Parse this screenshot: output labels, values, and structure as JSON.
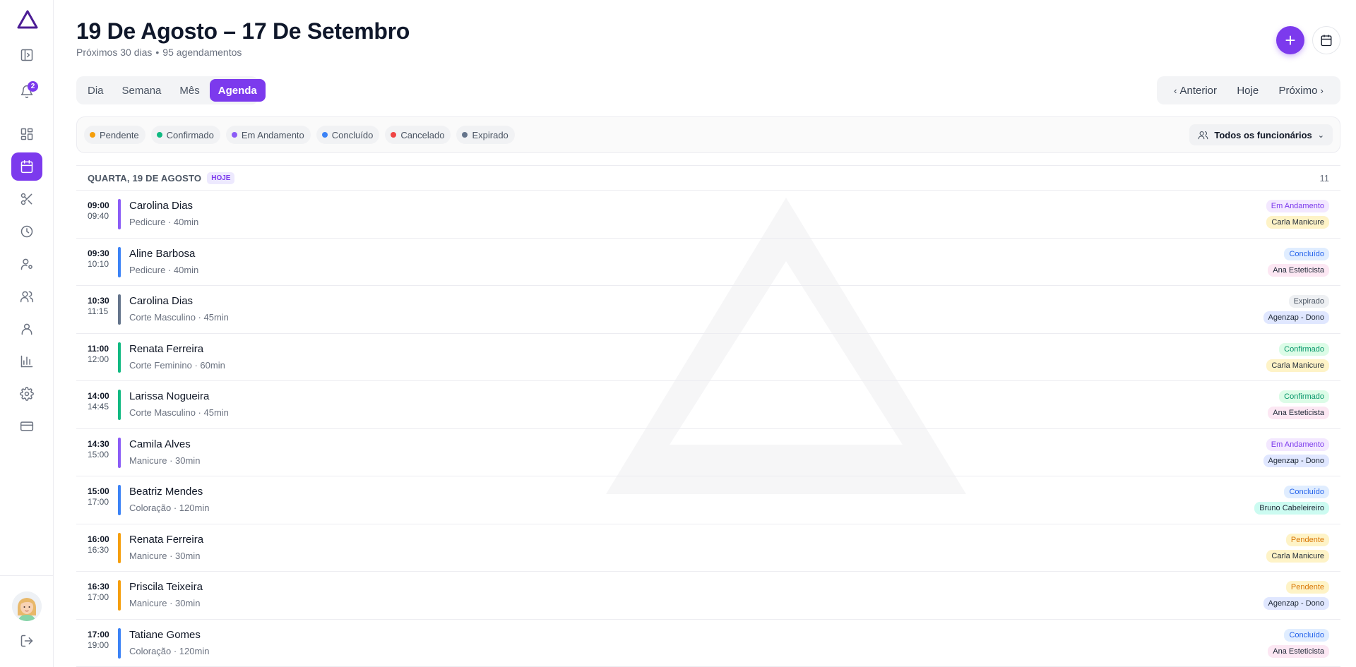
{
  "sidebar": {
    "notifications_count": "2",
    "items": [
      {
        "name": "sidebar-toggle-icon"
      },
      {
        "name": "bell-icon"
      },
      {
        "name": "dashboard-icon"
      },
      {
        "name": "calendar-icon",
        "active": true
      },
      {
        "name": "scissors-icon"
      },
      {
        "name": "clock-icon"
      },
      {
        "name": "user-settings-icon"
      },
      {
        "name": "users-icon"
      },
      {
        "name": "user-icon"
      },
      {
        "name": "bar-chart-icon"
      },
      {
        "name": "gear-icon"
      },
      {
        "name": "credit-card-icon"
      },
      {
        "name": "logout-icon"
      }
    ]
  },
  "header": {
    "title": "19 De Agosto – 17 De Setembro",
    "subtitle_range": "Próximos 30 dias",
    "subtitle_sep": "•",
    "subtitle_count": "95 agendamentos",
    "add_label": "+"
  },
  "view_tabs": [
    "Dia",
    "Semana",
    "Mês",
    "Agenda"
  ],
  "active_tab": "Agenda",
  "nav": {
    "prev": "Anterior",
    "today": "Hoje",
    "next": "Próximo"
  },
  "legend": [
    {
      "label": "Pendente",
      "color": "#f59e0b"
    },
    {
      "label": "Confirmado",
      "color": "#10b981"
    },
    {
      "label": "Em Andamento",
      "color": "#8b5cf6"
    },
    {
      "label": "Concluído",
      "color": "#3b82f6"
    },
    {
      "label": "Cancelado",
      "color": "#ef4444"
    },
    {
      "label": "Expirado",
      "color": "#64748b"
    }
  ],
  "employee_filter": "Todos os funcionários",
  "day": {
    "label": "QUARTA, 19 DE AGOSTO",
    "badge": "HOJE",
    "count": "11"
  },
  "status_styles": {
    "Em Andamento": {
      "bar": "#8b5cf6",
      "bg": "#f3e8ff",
      "fg": "#7c3aed"
    },
    "Concluído": {
      "bar": "#3b82f6",
      "bg": "#e0edff",
      "fg": "#2563eb"
    },
    "Expirado": {
      "bar": "#64748b",
      "bg": "#eef0f3",
      "fg": "#4b5563"
    },
    "Confirmado": {
      "bar": "#10b981",
      "bg": "#dcfce7",
      "fg": "#059669"
    },
    "Pendente": {
      "bar": "#f59e0b",
      "bg": "#fef3c7",
      "fg": "#d97706"
    }
  },
  "staff_styles": {
    "Carla Manicure": {
      "bg": "#fef3c7",
      "fg": "#1f2937"
    },
    "Ana Esteticista": {
      "bg": "#fce7f3",
      "fg": "#1f2937"
    },
    "Agenzap - Dono": {
      "bg": "#e0e7ff",
      "fg": "#1f2937"
    },
    "Bruno Cabeleireiro": {
      "bg": "#ccfbf1",
      "fg": "#1f2937"
    }
  },
  "appointments": [
    {
      "start": "09:00",
      "end": "09:40",
      "client": "Carolina Dias",
      "service": "Pedicure · 40min",
      "status": "Em Andamento",
      "staff": "Carla Manicure"
    },
    {
      "start": "09:30",
      "end": "10:10",
      "client": "Aline Barbosa",
      "service": "Pedicure · 40min",
      "status": "Concluído",
      "staff": "Ana Esteticista"
    },
    {
      "start": "10:30",
      "end": "11:15",
      "client": "Carolina Dias",
      "service": "Corte Masculino · 45min",
      "status": "Expirado",
      "staff": "Agenzap - Dono"
    },
    {
      "start": "11:00",
      "end": "12:00",
      "client": "Renata Ferreira",
      "service": "Corte Feminino · 60min",
      "status": "Confirmado",
      "staff": "Carla Manicure"
    },
    {
      "start": "14:00",
      "end": "14:45",
      "client": "Larissa Nogueira",
      "service": "Corte Masculino · 45min",
      "status": "Confirmado",
      "staff": "Ana Esteticista"
    },
    {
      "start": "14:30",
      "end": "15:00",
      "client": "Camila Alves",
      "service": "Manicure · 30min",
      "status": "Em Andamento",
      "staff": "Agenzap - Dono"
    },
    {
      "start": "15:00",
      "end": "17:00",
      "client": "Beatriz Mendes",
      "service": "Coloração · 120min",
      "status": "Concluído",
      "staff": "Bruno Cabeleireiro"
    },
    {
      "start": "16:00",
      "end": "16:30",
      "client": "Renata Ferreira",
      "service": "Manicure · 30min",
      "status": "Pendente",
      "staff": "Carla Manicure"
    },
    {
      "start": "16:30",
      "end": "17:00",
      "client": "Priscila Teixeira",
      "service": "Manicure · 30min",
      "status": "Pendente",
      "staff": "Agenzap - Dono"
    },
    {
      "start": "17:00",
      "end": "19:00",
      "client": "Tatiane Gomes",
      "service": "Coloração · 120min",
      "status": "Concluído",
      "staff": "Ana Esteticista"
    }
  ]
}
